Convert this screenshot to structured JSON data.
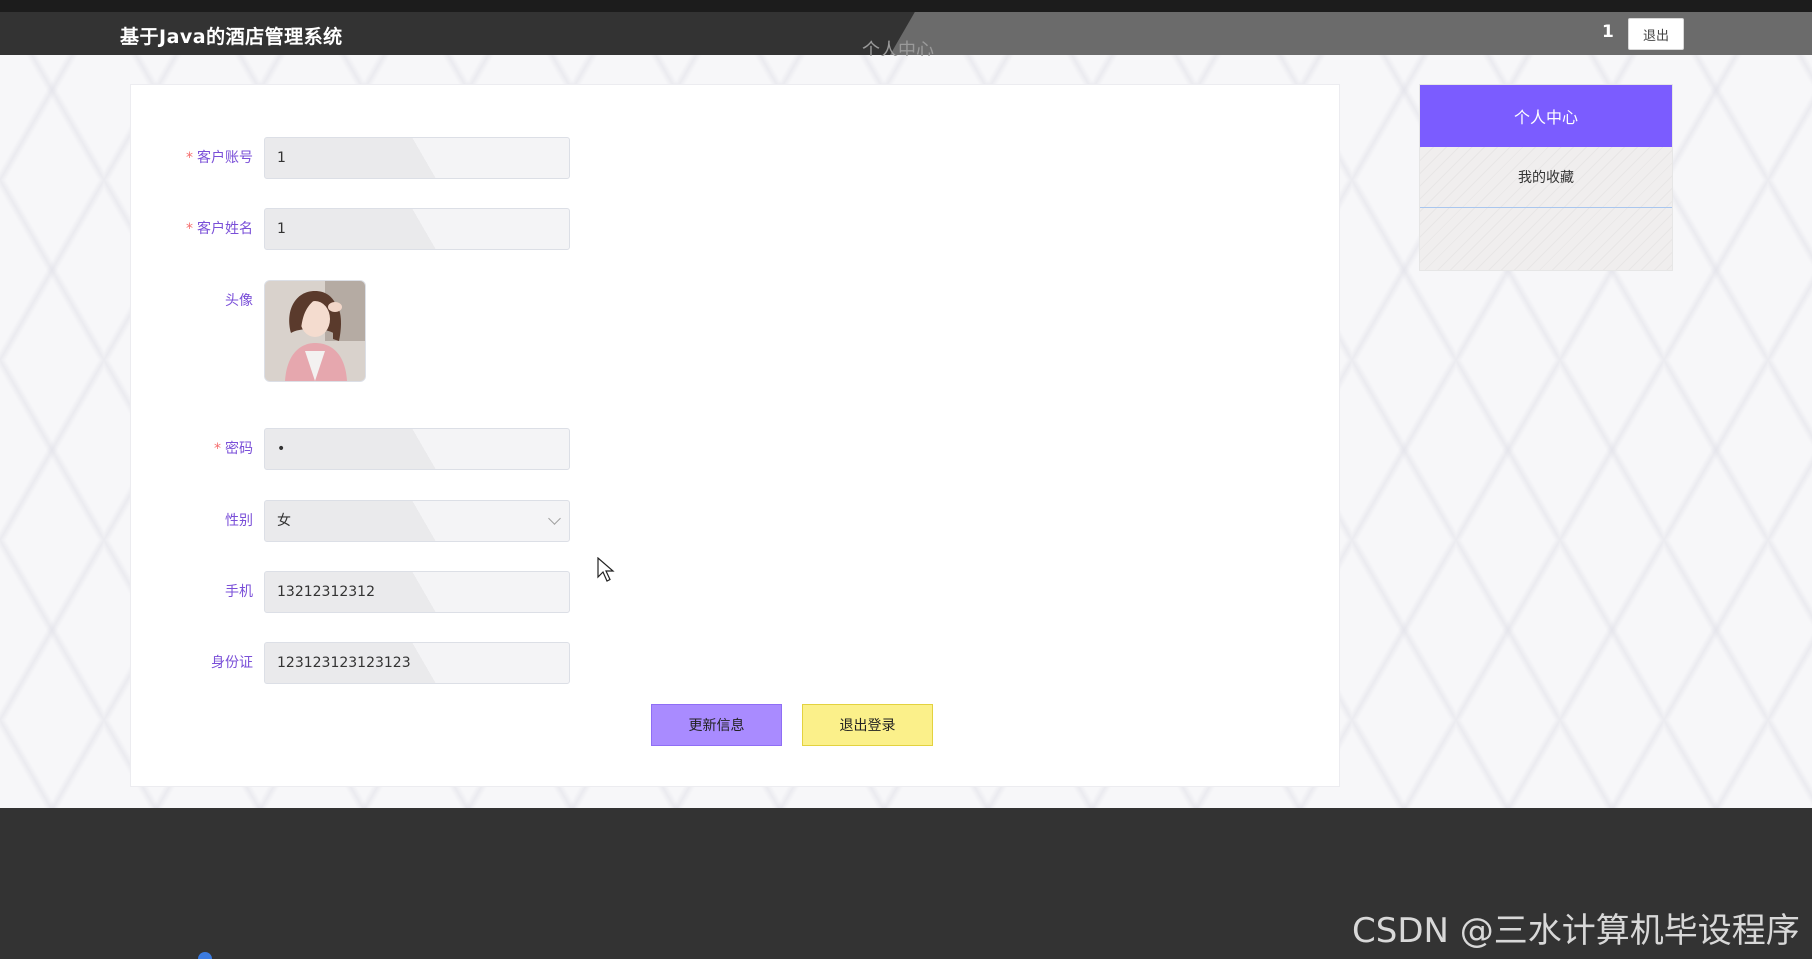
{
  "header": {
    "brand": "基于Java的酒店管理系统",
    "username": "1",
    "logout_label": "退出"
  },
  "page": {
    "ghost_title": "个人中心"
  },
  "form": {
    "account": {
      "label": "客户账号",
      "required": "*",
      "value": "1"
    },
    "name": {
      "label": "客户姓名",
      "required": "*",
      "value": "1"
    },
    "avatar": {
      "label": "头像"
    },
    "password": {
      "label": "密码",
      "required": "*",
      "value": "•"
    },
    "gender": {
      "label": "性别",
      "value": "女"
    },
    "phone": {
      "label": "手机",
      "value": "13212312312"
    },
    "id_card": {
      "label": "身份证",
      "value": "123123123123123"
    },
    "update_label": "更新信息",
    "logout_label": "退出登录"
  },
  "sidebar": {
    "items": [
      {
        "label": "个人中心",
        "active": true
      },
      {
        "label": "我的收藏",
        "active": false
      }
    ]
  },
  "footer": {
    "watermark": "CSDN @三水计算机毕设程序"
  },
  "colors": {
    "accent": "#7b5cff",
    "label": "#7a4fd8",
    "update_button": "#a98bff",
    "logout_button": "#fbf08a",
    "header": "#333333"
  }
}
